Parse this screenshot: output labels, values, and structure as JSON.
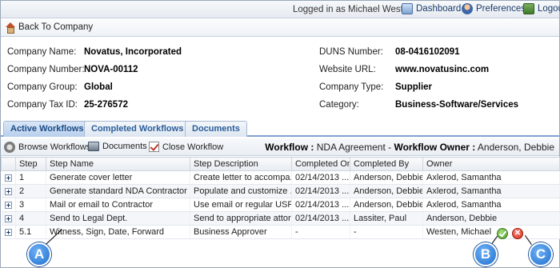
{
  "topbar": {
    "logged_in_text": "Logged in as Michael Westen",
    "dashboard": "Dashboard",
    "preferences": "Preferences",
    "logout": "Logout"
  },
  "back_label": "Back To Company",
  "company": {
    "left": [
      {
        "label": "Company Name:",
        "value": "Novatus, Incorporated"
      },
      {
        "label": "Company Number:",
        "value": "NOVA-00112"
      },
      {
        "label": "Company Group:",
        "value": "Global"
      },
      {
        "label": "Company Tax ID:",
        "value": "25-276572"
      }
    ],
    "right": [
      {
        "label": "DUNS Number:",
        "value": "08-0416102091"
      },
      {
        "label": "Website URL:",
        "value": "www.novatusinc.com"
      },
      {
        "label": "Company Type:",
        "value": "Supplier"
      },
      {
        "label": "Category:",
        "value": "Business-Software/Services"
      }
    ]
  },
  "tabs": [
    "Active Workflows",
    "Completed Workflows",
    "Documents"
  ],
  "toolbar": {
    "browse": "Browse Workflows",
    "documents": "Documents",
    "close": "Close Workflow",
    "workflow_label": "Workflow :",
    "workflow_name": "NDA Agreement",
    "owner_label": "Workflow Owner :",
    "owner_name": "Anderson, Debbie"
  },
  "table": {
    "columns": [
      "Step",
      "Step Name",
      "Step Description",
      "Completed On",
      "Completed By",
      "Owner"
    ],
    "rows": [
      [
        "1",
        "Generate cover letter",
        "Create letter to accompa...",
        "02/14/2013 ...",
        "Anderson, Debbie",
        "Axlerod, Samantha"
      ],
      [
        "2",
        "Generate standard NDA Contractor f...",
        "Populate and customize ...",
        "02/14/2013 ...",
        "Anderson, Debbie",
        "Axlerod, Samantha"
      ],
      [
        "3",
        "Mail or email to Contractor",
        "Use email or regular USP...",
        "02/14/2013 ...",
        "Anderson, Debbie",
        "Axlerod, Samantha"
      ],
      [
        "4",
        "Send to Legal Dept.",
        "Send to appropriate attor...",
        "02/14/2013 ...",
        "Lassiter, Paul",
        "Anderson, Debbie"
      ],
      [
        "5.1",
        "Witness, Sign, Date, Forward",
        "Business Approver",
        "-",
        "-",
        "Westen, Michael"
      ]
    ]
  },
  "reject_glyph": "✕",
  "markers": [
    "A",
    "B",
    "C"
  ]
}
